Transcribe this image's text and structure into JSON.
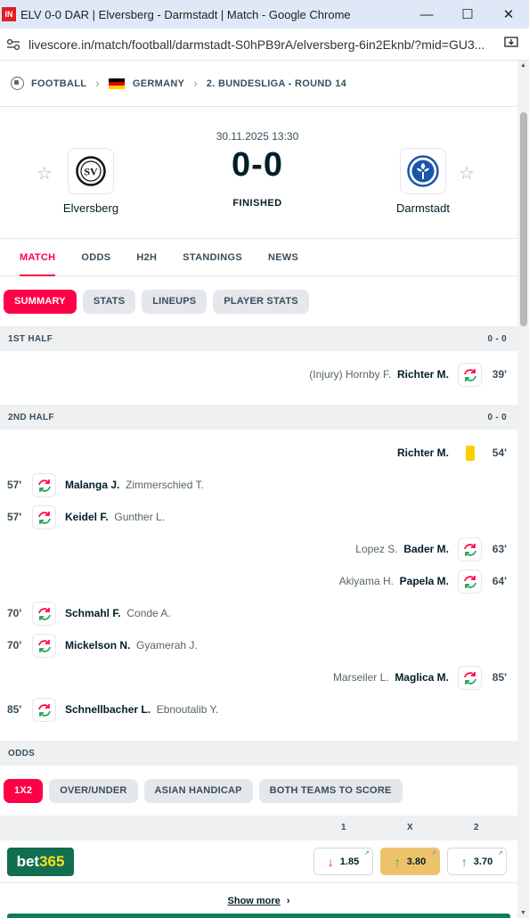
{
  "window": {
    "favicon_text": "IN",
    "title": "ELV 0-0 DAR | Elversberg - Darmstadt | Match - Google Chrome",
    "url": "livescore.in/match/football/darmstadt-S0hPB9rA/elversberg-6in2Eknb/?mid=GU3..."
  },
  "breadcrumb": {
    "sport": "FOOTBALL",
    "country": "GERMANY",
    "league": "2. BUNDESLIGA - ROUND 14"
  },
  "match": {
    "datetime": "30.11.2025 13:30",
    "score": "0-0",
    "status": "FINISHED",
    "home": {
      "name": "Elversberg",
      "abbr": "SV"
    },
    "away": {
      "name": "Darmstadt"
    }
  },
  "tabs": [
    "MATCH",
    "ODDS",
    "H2H",
    "STANDINGS",
    "NEWS"
  ],
  "subtabs": [
    "SUMMARY",
    "STATS",
    "LINEUPS",
    "PLAYER STATS"
  ],
  "halves": [
    {
      "label": "1ST HALF",
      "score": "0 - 0"
    },
    {
      "label": "2ND HALF",
      "score": "0 - 0"
    }
  ],
  "events": [
    {
      "minute": "39'",
      "team": "away",
      "type": "substitution",
      "player_in": "Richter M.",
      "player_out": "(Injury) Hornby F."
    },
    {
      "minute": "54'",
      "team": "away",
      "type": "yellow-card",
      "player_in": "Richter M.",
      "player_out": ""
    },
    {
      "minute": "57'",
      "team": "home",
      "type": "substitution",
      "player_in": "Malanga J.",
      "player_out": "Zimmerschied T."
    },
    {
      "minute": "57'",
      "team": "home",
      "type": "substitution",
      "player_in": "Keidel F.",
      "player_out": "Gunther L."
    },
    {
      "minute": "63'",
      "team": "away",
      "type": "substitution",
      "player_in": "Bader M.",
      "player_out": "Lopez S."
    },
    {
      "minute": "64'",
      "team": "away",
      "type": "substitution",
      "player_in": "Papela M.",
      "player_out": "Akiyama H."
    },
    {
      "minute": "70'",
      "team": "home",
      "type": "substitution",
      "player_in": "Schmahl F.",
      "player_out": "Conde A."
    },
    {
      "minute": "70'",
      "team": "home",
      "type": "substitution",
      "player_in": "Mickelson N.",
      "player_out": "Gyamerah J."
    },
    {
      "minute": "85'",
      "team": "away",
      "type": "substitution",
      "player_in": "Maglica M.",
      "player_out": "Marseiler L."
    },
    {
      "minute": "85'",
      "team": "home",
      "type": "substitution",
      "player_in": "Schnellbacher L.",
      "player_out": "Ebnoutalib Y."
    }
  ],
  "odds": {
    "section_label": "ODDS",
    "markets": [
      "1X2",
      "OVER/UNDER",
      "ASIAN HANDICAP",
      "BOTH TEAMS TO SCORE"
    ],
    "columns": [
      "1",
      "X",
      "2"
    ],
    "bookmaker": {
      "name_part1": "bet",
      "name_part2": "365"
    },
    "values": [
      {
        "value": "1.85",
        "trend": "down",
        "highlight": false
      },
      {
        "value": "3.80",
        "trend": "up",
        "highlight": true
      },
      {
        "value": "3.70",
        "trend": "up",
        "highlight": false
      }
    ],
    "show_more": "Show more"
  },
  "colors": {
    "accent": "#ff0046",
    "sub_in": "#1ba34a",
    "sub_out": "#ff0046",
    "yellow_card": "#ffcd00",
    "odds_highlight": "#ecc36b",
    "bet365": "#126e51"
  }
}
